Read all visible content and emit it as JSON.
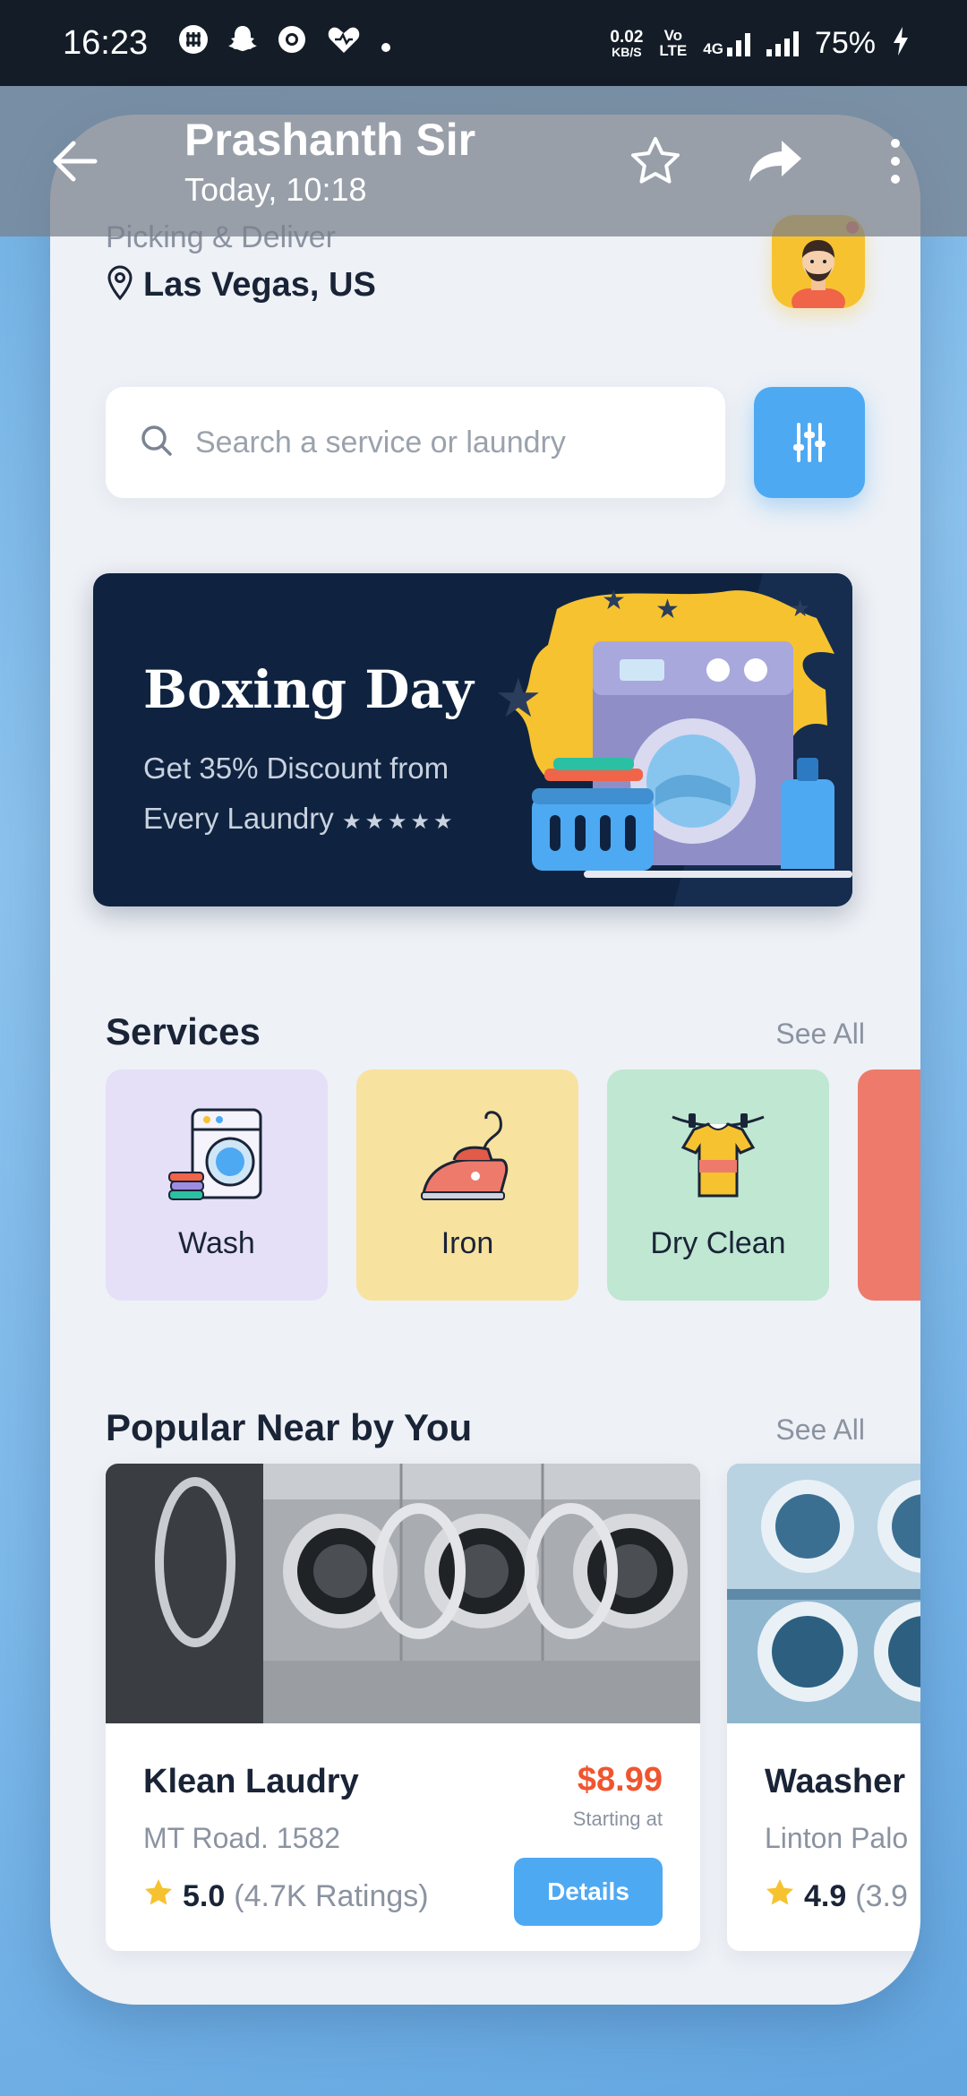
{
  "status_bar": {
    "time": "16:23",
    "notification_icons": [
      "slack-icon",
      "snapchat-icon",
      "chrome-icon",
      "health-heart-icon",
      "dot-icon"
    ],
    "net_speed_value": "0.02",
    "net_speed_unit": "KB/S",
    "volte_top": "Vo",
    "volte_bottom": "LTE",
    "network": "4G",
    "battery": "75%"
  },
  "viewer": {
    "contact_name": "Prashanth Sir",
    "timestamp": "Today, 10:18"
  },
  "app": {
    "location_label": "Picking & Deliver",
    "location": "Las Vegas, US",
    "search_placeholder": "Search a service or laundry",
    "banner": {
      "title": "Boxing Day",
      "subtitle_line1": "Get 35% Discount from",
      "subtitle_line2": "Every Laundry",
      "stars": "★★★★★"
    },
    "services": {
      "title": "Services",
      "see_all": "See All",
      "items": [
        {
          "label": "Wash",
          "icon": "washing-machine-icon",
          "color": "#e5e0f7"
        },
        {
          "label": "Iron",
          "icon": "iron-icon",
          "color": "#f8e29f"
        },
        {
          "label": "Dry Clean",
          "icon": "shirt-hanger-icon",
          "color": "#bfe7d2"
        },
        {
          "label": "",
          "icon": "",
          "color": "#ee7a6b"
        }
      ]
    },
    "popular": {
      "title": "Popular Near by You",
      "see_all": "See All",
      "shops": [
        {
          "name": "Klean Laudry",
          "address": "MT Road. 1582",
          "rating": "5.0",
          "ratings_count": "(4.7K Ratings)",
          "price": "$8.99",
          "price_note": "Starting at",
          "button": "Details"
        },
        {
          "name": "Waasher",
          "address": "Linton Palo",
          "rating": "4.9",
          "ratings_count": "(3.9"
        }
      ]
    }
  },
  "colors": {
    "accent": "#4ea9f3",
    "price": "#f0552f",
    "banner_bg": "#0f2340"
  }
}
